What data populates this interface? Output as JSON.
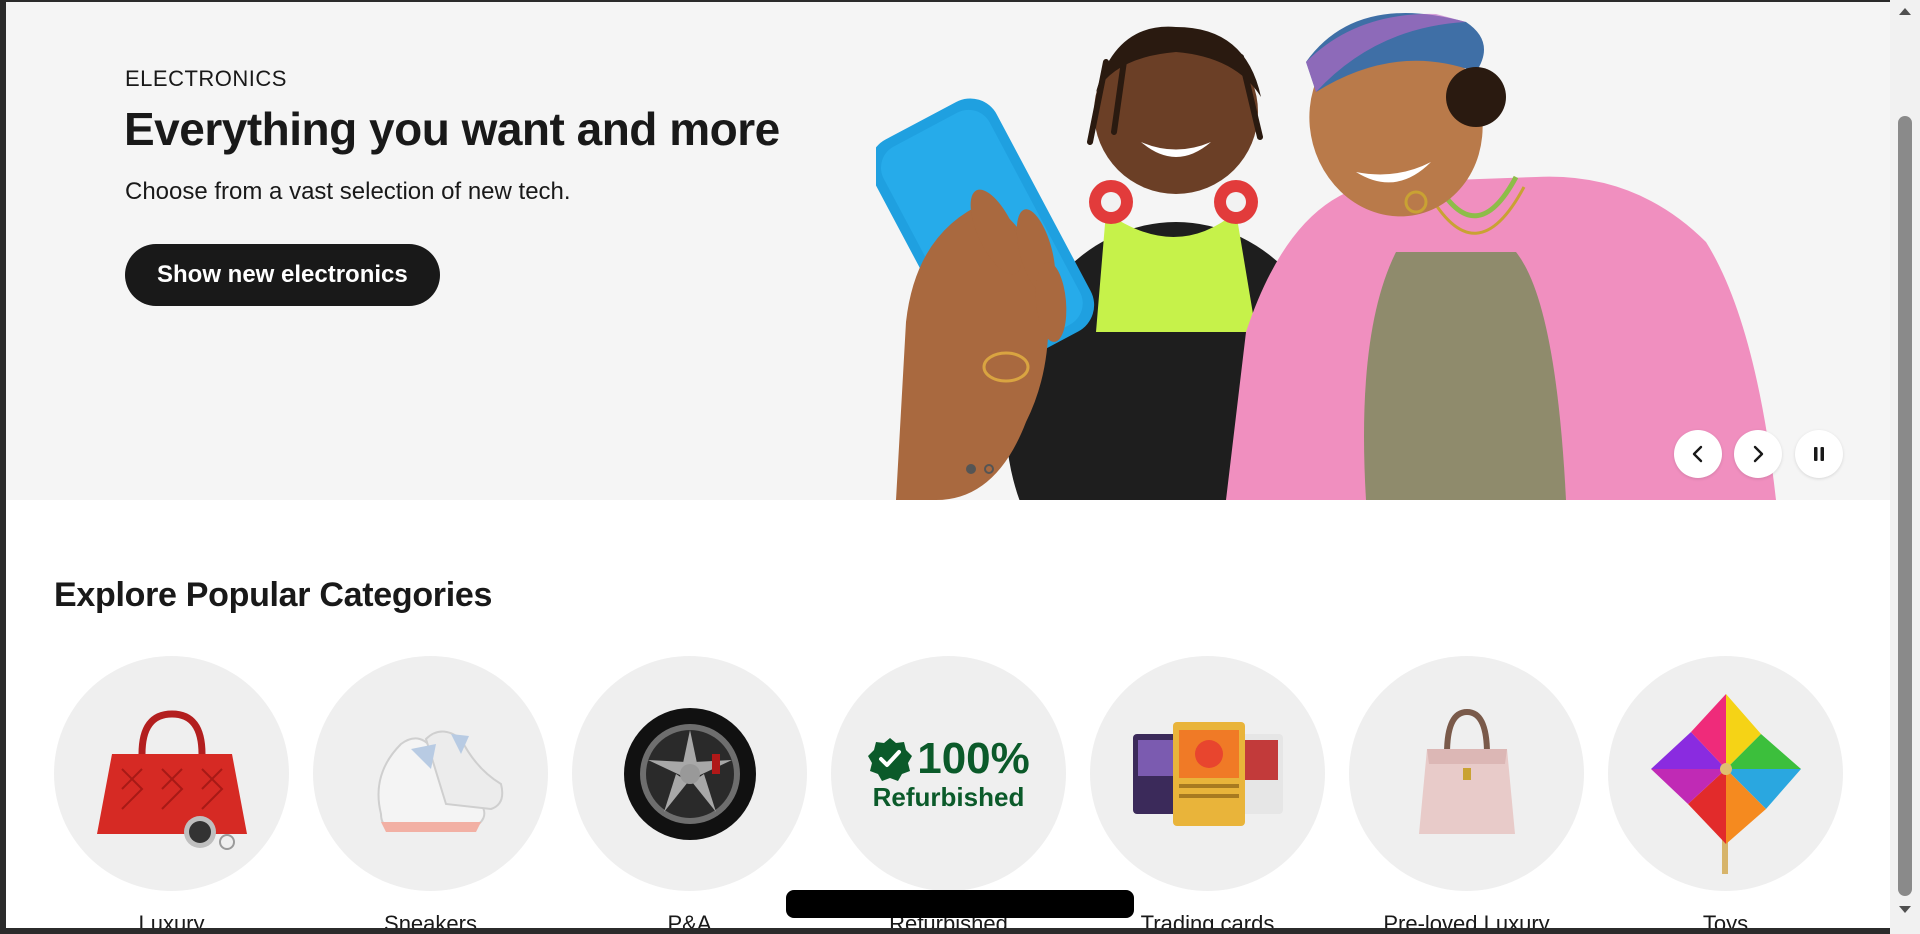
{
  "hero": {
    "eyebrow": "ELECTRONICS",
    "title": "Everything you want and more",
    "subtitle": "Choose from a vast selection of new tech.",
    "cta_label": "Show new electronics",
    "background_color": "#f5f5f5",
    "slide_count": 2,
    "active_slide": 1,
    "controls": [
      "previous-slide",
      "next-slide",
      "pause"
    ]
  },
  "categories": {
    "title": "Explore Popular Categories",
    "items": [
      {
        "label": "Luxury",
        "icon": "red-handbag-watch"
      },
      {
        "label": "Sneakers",
        "icon": "sneakers"
      },
      {
        "label": "P&A",
        "icon": "wheel"
      },
      {
        "label": "Refurbished",
        "icon": "refurbished-badge",
        "badge_text": "100%",
        "badge_sub": "Refurbished"
      },
      {
        "label": "Trading cards",
        "icon": "trading-cards"
      },
      {
        "label": "Pre-loved Luxury",
        "icon": "pink-tote-bag"
      },
      {
        "label": "Toys",
        "icon": "pinwheel"
      }
    ]
  },
  "colors": {
    "primary_text": "#191919",
    "cta_bg": "#191919",
    "refurbished_green": "#0b5a2a",
    "circle_bg": "#efefef"
  }
}
